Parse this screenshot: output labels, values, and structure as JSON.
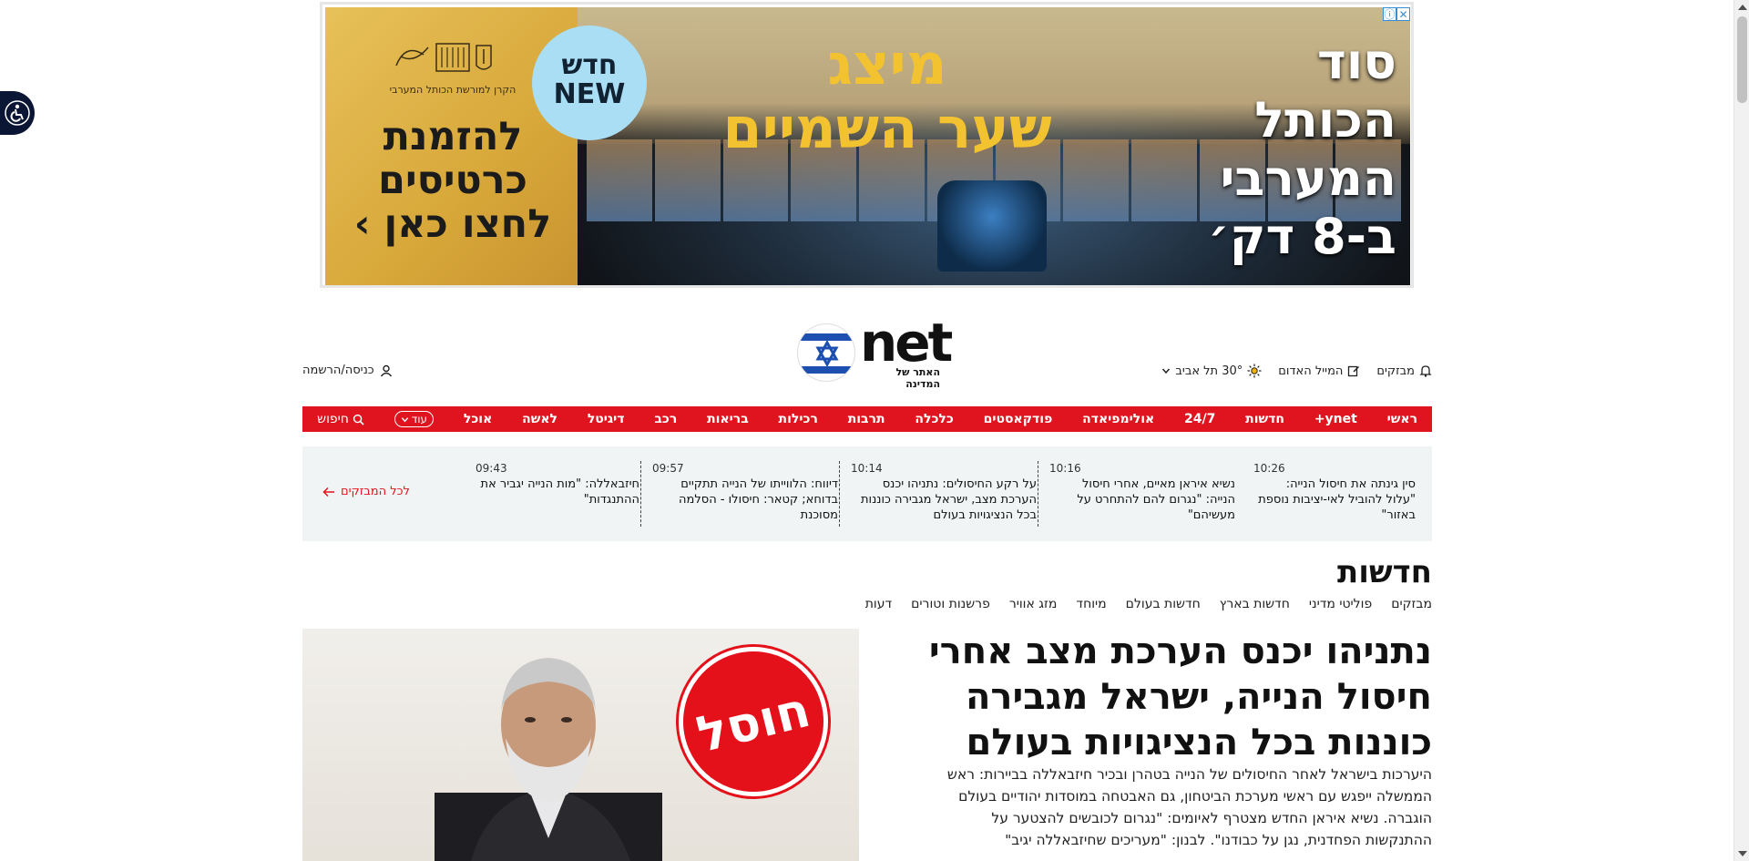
{
  "ad": {
    "left_cta": "להזמנת כרטיסים לחצו כאן ›",
    "left_org": "הקרן למורשת הכותל המערבי",
    "badge_he": "חדש",
    "badge_en": "NEW",
    "title_line1": "מיצג",
    "title_line2": "שער השמיים",
    "right_text": "סוד הכותל המערבי ב-8 דק׳"
  },
  "header": {
    "logo_text": "net",
    "logo_sub": "האתר של המדינה",
    "login_label": "כניסה/הרשמה",
    "utils": [
      {
        "label": "מבזקים",
        "icon": "bell-icon"
      },
      {
        "label": "המייל האדום",
        "icon": "edit-icon"
      },
      {
        "label": "30° תל אביב",
        "icon": "sun-icon"
      }
    ]
  },
  "nav": {
    "items": [
      "ראשי",
      "ynet+",
      "חדשות",
      "24/7",
      "אולימפיאדה",
      "פודקאסטים",
      "כלכלה",
      "תרבות",
      "רכילות",
      "בריאות",
      "רכב",
      "דיגיטל",
      "לאשה",
      "אוכל"
    ],
    "more_label": "עוד",
    "search_label": "חיפוש",
    "active": "חדשות"
  },
  "flash": {
    "items": [
      {
        "time": "10:26",
        "text": "סין גינתה את חיסול הנייה: \"עלול להוביל לאי-יציבות נוספת באזור\""
      },
      {
        "time": "10:16",
        "text": "נשיא איראן מאיים, אחרי חיסול הנייה: \"נגרום להם להתחרט על מעשיהם\""
      },
      {
        "time": "10:14",
        "text": "על רקע החיסולים: נתניהו יכנס הערכת מצב, ישראל מגבירה כוננות בכל הנציגויות בעולם"
      },
      {
        "time": "09:57",
        "text": "דיווח: הלווייתו של הנייה תתקיים בדוחא; קטאר: חיסולו - הסלמה מסוכנת"
      },
      {
        "time": "09:43",
        "text": "חיזבאללה: \"מות הנייה יגביר את ההתנגדות\""
      }
    ],
    "all_label": "לכל המבזקים"
  },
  "section": {
    "title": "חדשות",
    "subnav": [
      "מבזקים",
      "פוליטי מדיני",
      "חדשות בארץ",
      "חדשות בעולם",
      "מיוחד",
      "מזג אוויר",
      "פרשנות וטורים",
      "דעות"
    ]
  },
  "article": {
    "headline": "נתניהו יכנס הערכת מצב אחרי חיסול הנייה, ישראל מגבירה כוננות בכל הנציגויות בעולם",
    "summary": "היערכות בישראל לאחר החיסולים של הנייה בטהרן ובכיר חיזבאללה בביירות: ראש הממשלה ייפגש עם ראשי מערכת הביטחון, גם האבטחה במוסדות יהודיים בעולם הוגברה. נשיא איראן החדש מצטרף לאיומים: \"נגרום לכובשים להצטער על ההתנקשות הפחדנית, נגן על כבודנו\". לבנון: \"מעריכים שחיזבאללה יגיב\"",
    "stamp": "חוסל"
  },
  "colors": {
    "brand_red": "#e0141e",
    "ad_gold": "#f2c230"
  }
}
